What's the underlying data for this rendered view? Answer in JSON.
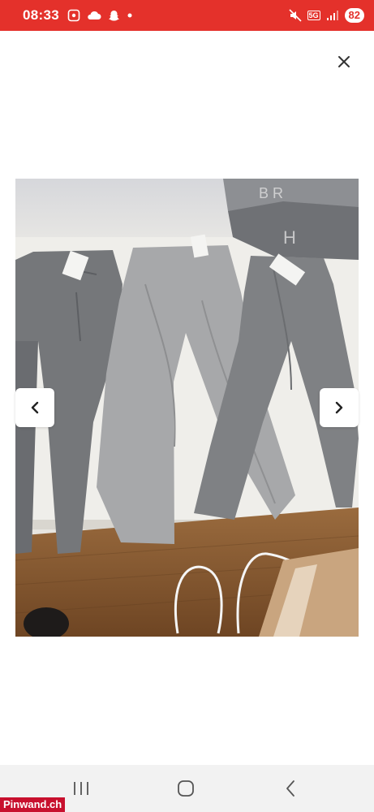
{
  "status_bar": {
    "time": "08:33",
    "network": "5G",
    "battery": "82",
    "accent_color": "#e4312b"
  },
  "viewer": {
    "close_icon": "close-icon",
    "prev_icon": "chevron-left-icon",
    "next_icon": "chevron-right-icon",
    "image_alt": "three pairs of grey jeans"
  },
  "system_nav": {
    "recents_icon": "recents-icon",
    "home_icon": "home-icon",
    "back_icon": "back-icon"
  },
  "watermark": {
    "text": "Pinwand.ch",
    "color": "#c8102e"
  }
}
